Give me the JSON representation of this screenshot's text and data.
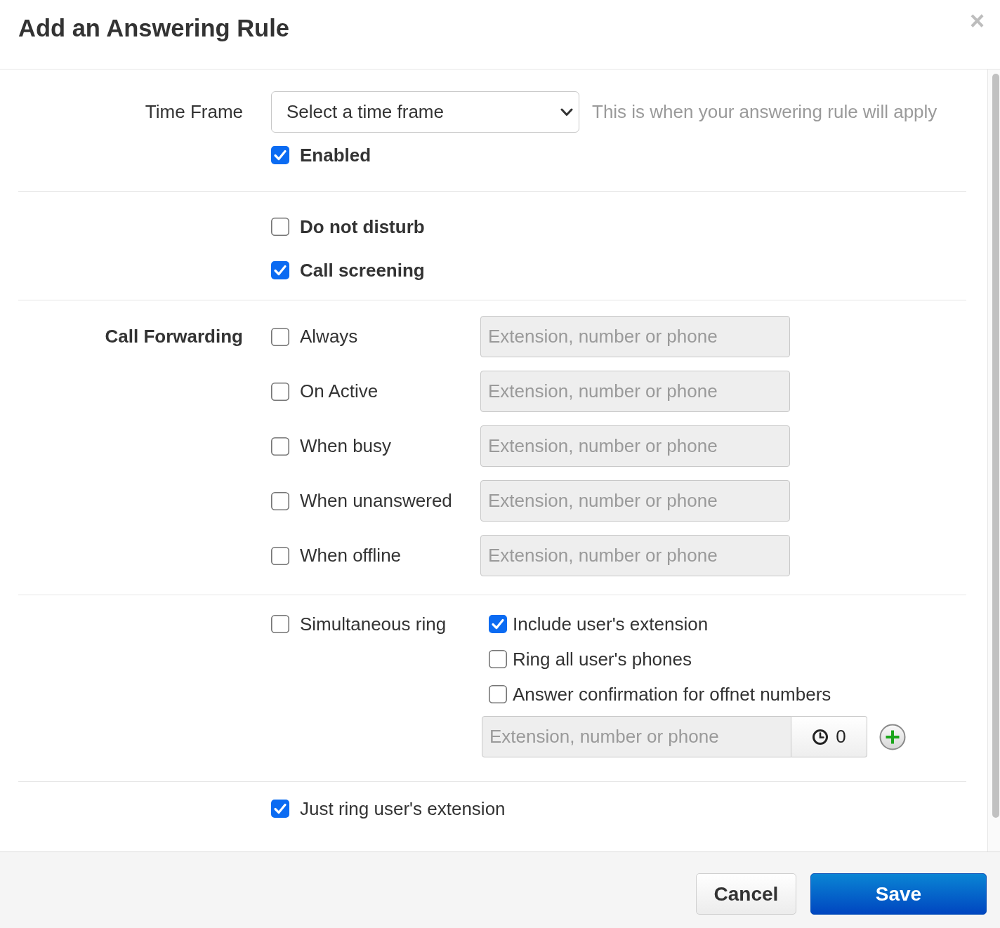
{
  "dialog": {
    "title": "Add an Answering Rule",
    "close": "×"
  },
  "time_frame": {
    "label": "Time Frame",
    "select": {
      "value": "Select a time frame"
    },
    "hint": "This is when your answering rule will apply",
    "enabled": {
      "label": "Enabled",
      "checked": true
    }
  },
  "status_options": [
    {
      "label": "Do not disturb",
      "checked": false
    },
    {
      "label": "Call screening",
      "checked": true
    }
  ],
  "call_forwarding": {
    "label": "Call Forwarding",
    "rules": [
      {
        "label": "Always",
        "checked": false,
        "placeholder": "Extension, number or phone",
        "disabled": true
      },
      {
        "label": "On Active",
        "checked": false,
        "placeholder": "Extension, number or phone",
        "disabled": true
      },
      {
        "label": "When busy",
        "checked": false,
        "placeholder": "Extension, number or phone",
        "disabled": true
      },
      {
        "label": "When unanswered",
        "checked": false,
        "placeholder": "Extension, number or phone",
        "disabled": true
      },
      {
        "label": "When offline",
        "checked": false,
        "placeholder": "Extension, number or phone",
        "disabled": true
      }
    ]
  },
  "simultaneous_ring": {
    "label": "Simultaneous ring",
    "checked": false,
    "options": [
      {
        "label": "Include user's extension",
        "checked": true
      },
      {
        "label": "Ring all user's phones",
        "checked": false
      },
      {
        "label": "Answer confirmation for offnet numbers",
        "checked": false
      }
    ],
    "entry": {
      "placeholder": "Extension, number or phone",
      "disabled": true,
      "delay": "0"
    }
  },
  "just_ring": {
    "label": "Just ring user's extension",
    "checked": true
  },
  "buttons": [
    {
      "label": "Cancel",
      "kind": "secondary"
    },
    {
      "label": "Save",
      "kind": "primary"
    }
  ]
}
